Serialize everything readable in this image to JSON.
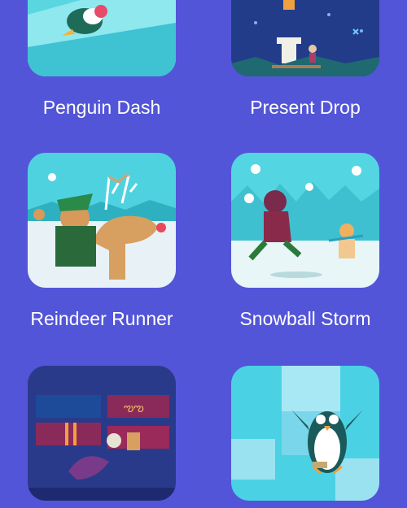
{
  "games": [
    {
      "title": "Penguin Dash",
      "icon": "penguin-dash-thumbnail"
    },
    {
      "title": "Present Drop",
      "icon": "present-drop-thumbnail"
    },
    {
      "title": "Reindeer Runner",
      "icon": "reindeer-runner-thumbnail"
    },
    {
      "title": "Snowball Storm",
      "icon": "snowball-storm-thumbnail"
    },
    {
      "title": "",
      "icon": "elf-workshop-thumbnail"
    },
    {
      "title": "",
      "icon": "penguin-ice-thumbnail"
    }
  ],
  "colors": {
    "background": "#5355d8",
    "label": "#ffffff"
  }
}
